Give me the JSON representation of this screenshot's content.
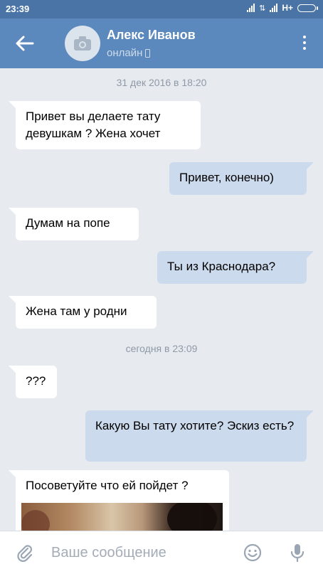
{
  "status_bar": {
    "time": "23:39",
    "network": "H+"
  },
  "header": {
    "contact_name": "Алекс Иванов",
    "presence": "онлайн"
  },
  "chat": {
    "dates": [
      "31 дек 2016 в 18:20",
      "сегодня в 23:09"
    ],
    "messages": [
      {
        "direction": "in",
        "text": "Привет вы делаете тату девушкам ? Жена хочет"
      },
      {
        "direction": "out",
        "text": "Привет, конечно)"
      },
      {
        "direction": "in",
        "text": "Думам на попе"
      },
      {
        "direction": "out",
        "text": "Ты из Краснодара?"
      },
      {
        "direction": "in",
        "text": "Жена там у родни"
      },
      {
        "direction": "in",
        "text": "???"
      },
      {
        "direction": "out",
        "text": "Какую Вы тату хотите? Эскиз есть?"
      },
      {
        "direction": "in",
        "text": "Посоветуйте что ей пойдет ?"
      }
    ]
  },
  "input": {
    "placeholder": "Ваше сообщение"
  },
  "icons": {
    "back": "arrow-left-icon",
    "avatar": "camera-icon",
    "presence": "mobile-phone-icon",
    "menu": "more-vertical-icon",
    "attach": "paperclip-icon",
    "emoji": "smile-icon",
    "voice": "microphone-icon"
  },
  "colors": {
    "header": "#5b88bd",
    "statusbar": "#4a74a5",
    "background": "#e7ebf0",
    "outgoing_bubble": "#cbdaec",
    "incoming_bubble": "#ffffff"
  }
}
